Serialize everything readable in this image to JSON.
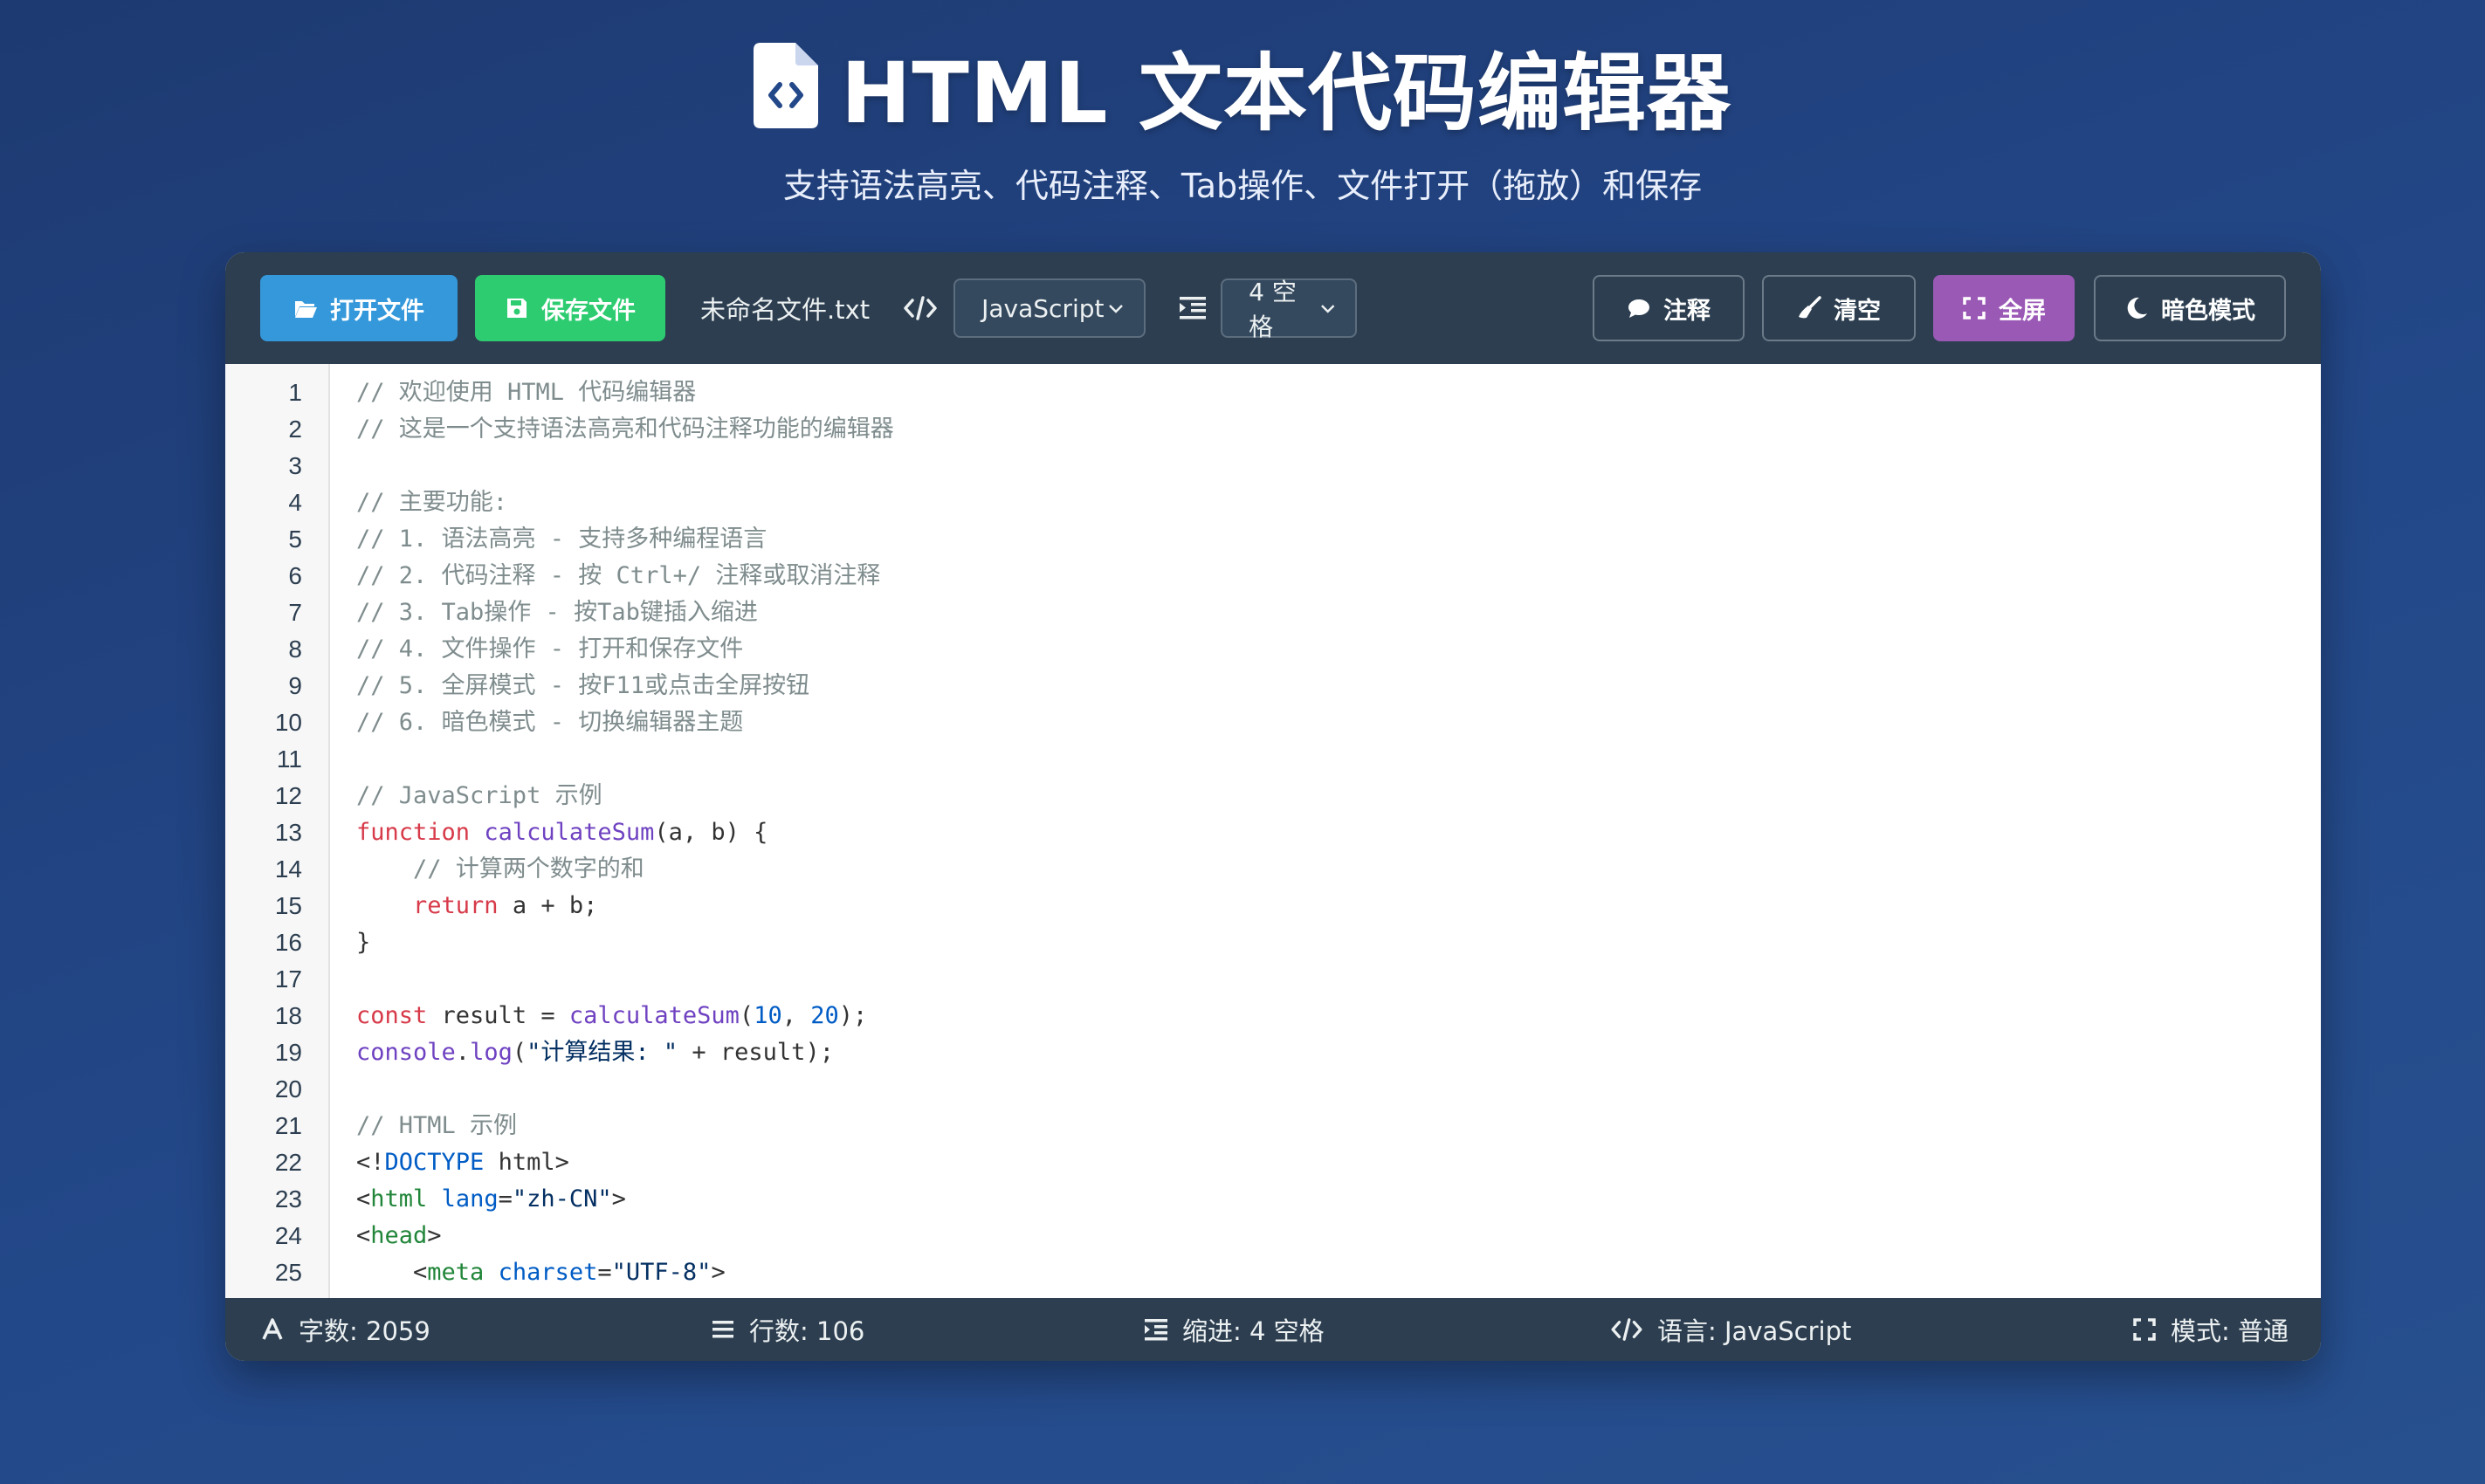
{
  "header": {
    "title": "HTML 文本代码编辑器",
    "subtitle": "支持语法高亮、代码注释、Tab操作、文件打开（拖放）和保存"
  },
  "toolbar": {
    "open_label": "打开文件",
    "save_label": "保存文件",
    "filename": "未命名文件.txt",
    "language_selected": "JavaScript",
    "indent_selected": "4 空格",
    "comment_label": "注释",
    "clear_label": "清空",
    "fullscreen_label": "全屏",
    "dark_label": "暗色模式"
  },
  "colors": {
    "open_button": "#3498db",
    "save_button": "#2ecc71",
    "fullscreen_button": "#9b59b6",
    "toolbar_bg": "#2c3e50"
  },
  "editor": {
    "line_numbers": [
      "1",
      "2",
      "3",
      "4",
      "5",
      "6",
      "7",
      "8",
      "9",
      "10",
      "11",
      "12",
      "13",
      "14",
      "15",
      "16",
      "17",
      "18",
      "19",
      "20",
      "21",
      "22",
      "23",
      "24",
      "25"
    ],
    "lines": [
      [
        {
          "c": "c",
          "t": "// 欢迎使用 HTML 代码编辑器"
        }
      ],
      [
        {
          "c": "c",
          "t": "// 这是一个支持语法高亮和代码注释功能的编辑器"
        }
      ],
      [],
      [
        {
          "c": "c",
          "t": "// 主要功能:"
        }
      ],
      [
        {
          "c": "c",
          "t": "// 1. 语法高亮 - 支持多种编程语言"
        }
      ],
      [
        {
          "c": "c",
          "t": "// 2. 代码注释 - 按 Ctrl+/ 注释或取消注释"
        }
      ],
      [
        {
          "c": "c",
          "t": "// 3. Tab操作 - 按Tab键插入缩进"
        }
      ],
      [
        {
          "c": "c",
          "t": "// 4. 文件操作 - 打开和保存文件"
        }
      ],
      [
        {
          "c": "c",
          "t": "// 5. 全屏模式 - 按F11或点击全屏按钮"
        }
      ],
      [
        {
          "c": "c",
          "t": "// 6. 暗色模式 - 切换编辑器主题"
        }
      ],
      [],
      [
        {
          "c": "c",
          "t": "// JavaScript 示例"
        }
      ],
      [
        {
          "c": "k",
          "t": "function "
        },
        {
          "c": "f",
          "t": "calculateSum"
        },
        {
          "c": "p",
          "t": "(a, b) {"
        }
      ],
      [
        {
          "c": "p",
          "t": "    "
        },
        {
          "c": "c",
          "t": "// 计算两个数字的和"
        }
      ],
      [
        {
          "c": "p",
          "t": "    "
        },
        {
          "c": "k",
          "t": "return"
        },
        {
          "c": "p",
          "t": " a + b;"
        }
      ],
      [
        {
          "c": "p",
          "t": "}"
        }
      ],
      [],
      [
        {
          "c": "k",
          "t": "const"
        },
        {
          "c": "p",
          "t": " result = "
        },
        {
          "c": "f",
          "t": "calculateSum"
        },
        {
          "c": "p",
          "t": "("
        },
        {
          "c": "n",
          "t": "10"
        },
        {
          "c": "p",
          "t": ", "
        },
        {
          "c": "n",
          "t": "20"
        },
        {
          "c": "p",
          "t": ");"
        }
      ],
      [
        {
          "c": "f",
          "t": "console"
        },
        {
          "c": "p",
          "t": "."
        },
        {
          "c": "f",
          "t": "log"
        },
        {
          "c": "p",
          "t": "("
        },
        {
          "c": "s",
          "t": "\"计算结果: \""
        },
        {
          "c": "p",
          "t": " + result);"
        }
      ],
      [],
      [
        {
          "c": "c",
          "t": "// HTML 示例"
        }
      ],
      [
        {
          "c": "p",
          "t": "<!"
        },
        {
          "c": "a",
          "t": "DOCTYPE"
        },
        {
          "c": "p",
          "t": " html>"
        }
      ],
      [
        {
          "c": "p",
          "t": "<"
        },
        {
          "c": "t",
          "t": "html"
        },
        {
          "c": "p",
          "t": " "
        },
        {
          "c": "a",
          "t": "lang"
        },
        {
          "c": "p",
          "t": "="
        },
        {
          "c": "s",
          "t": "\"zh-CN\""
        },
        {
          "c": "p",
          "t": ">"
        }
      ],
      [
        {
          "c": "p",
          "t": "<"
        },
        {
          "c": "t",
          "t": "head"
        },
        {
          "c": "p",
          "t": ">"
        }
      ],
      [
        {
          "c": "p",
          "t": "    <"
        },
        {
          "c": "t",
          "t": "meta"
        },
        {
          "c": "p",
          "t": " "
        },
        {
          "c": "a",
          "t": "charset"
        },
        {
          "c": "p",
          "t": "="
        },
        {
          "c": "s",
          "t": "\"UTF-8\""
        },
        {
          "c": "p",
          "t": ">"
        }
      ]
    ]
  },
  "status": {
    "chars": "字数: 2059",
    "lines": "行数: 106",
    "indent": "缩进: 4 空格",
    "language": "语言: JavaScript",
    "mode": "模式: 普通"
  }
}
